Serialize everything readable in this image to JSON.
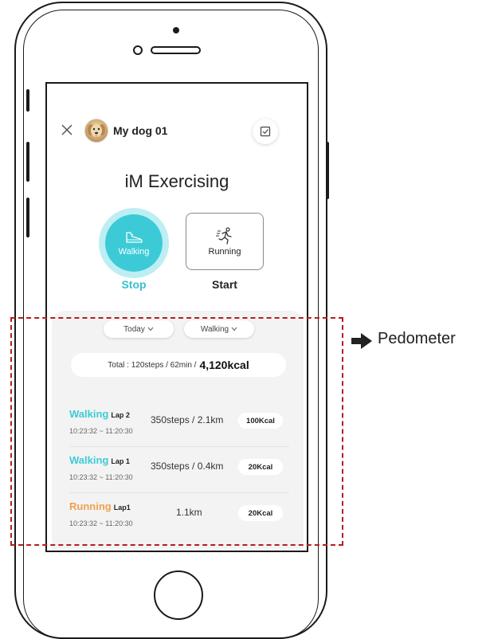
{
  "header": {
    "dog_name": "My dog 01"
  },
  "title": "iM Exercising",
  "modes": {
    "walking_label": "Walking",
    "running_label": "Running",
    "stop_label": "Stop",
    "start_label": "Start"
  },
  "filters": {
    "period": "Today",
    "activity": "Walking"
  },
  "total": {
    "prefix": "Total  :  120steps / 62min /",
    "kcal": "4,120kcal"
  },
  "laps": [
    {
      "type": "Walking",
      "lap": "Lap 2",
      "time": "10:23:32 ~ 11:20:30",
      "stats": "350steps  /  2.1km",
      "kcal": "100Kcal"
    },
    {
      "type": "Walking",
      "lap": "Lap 1",
      "time": "10:23:32 ~ 11:20:30",
      "stats": "350steps  /  0.4km",
      "kcal": "20Kcal"
    },
    {
      "type": "Running",
      "lap": "Lap1",
      "time": "10:23:32 ~ 11:20:30",
      "stats": "1.1km",
      "kcal": "20Kcal"
    }
  ],
  "annotation": {
    "label": "Pedometer"
  },
  "colors": {
    "accent_teal": "#3ccbd6",
    "running_orange": "#f0a050",
    "annotation_red": "#b81c1c"
  }
}
